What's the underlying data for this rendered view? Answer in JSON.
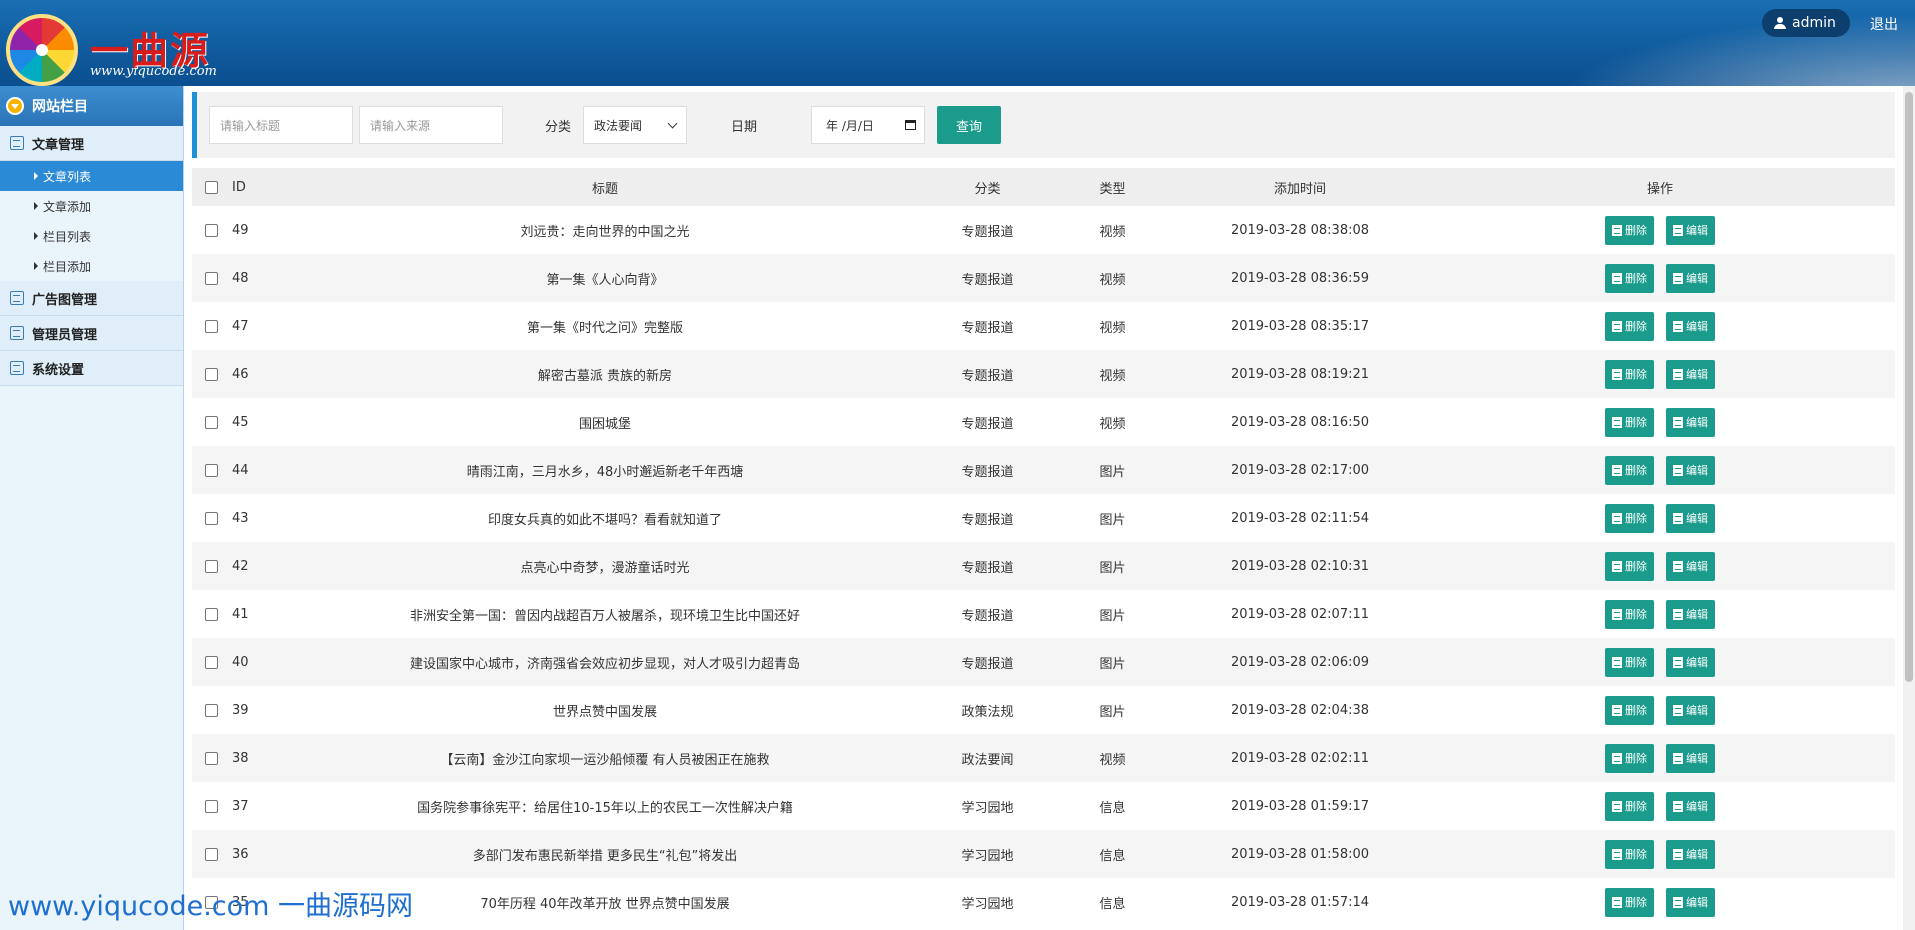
{
  "header": {
    "brand": "一曲源码",
    "brand_url": "www.yiqucode.com",
    "user": "admin",
    "logout": "退出"
  },
  "sidebar": {
    "title": "网站栏目",
    "groups": [
      {
        "label": "文章管理",
        "icon": "article-icon"
      },
      {
        "label": "广告图管理",
        "icon": "image-icon"
      },
      {
        "label": "管理员管理",
        "icon": "edit-icon"
      },
      {
        "label": "系统设置",
        "icon": "calendar-icon"
      }
    ],
    "subitems": [
      {
        "label": "文章列表",
        "active": true
      },
      {
        "label": "文章添加",
        "active": false
      },
      {
        "label": "栏目列表",
        "active": false
      },
      {
        "label": "栏目添加",
        "active": false
      }
    ]
  },
  "search": {
    "title_placeholder": "请输入标题",
    "source_placeholder": "请输入来源",
    "category_label": "分类",
    "category_value": "政法要闻",
    "date_label": "日期",
    "date_value": "年 /月/日",
    "query_button": "查询"
  },
  "table": {
    "headers": {
      "id": "ID",
      "title": "标题",
      "category": "分类",
      "type": "类型",
      "time": "添加时间",
      "ops": "操作"
    },
    "delete_label": "删除",
    "edit_label": "编辑",
    "rows": [
      {
        "id": "49",
        "title": "刘远贵：走向世界的中国之光",
        "category": "专题报道",
        "type": "视频",
        "time": "2019-03-28 08:38:08"
      },
      {
        "id": "48",
        "title": "第一集《人心向背》",
        "category": "专题报道",
        "type": "视频",
        "time": "2019-03-28 08:36:59"
      },
      {
        "id": "47",
        "title": "第一集《时代之问》完整版",
        "category": "专题报道",
        "type": "视频",
        "time": "2019-03-28 08:35:17"
      },
      {
        "id": "46",
        "title": "解密古墓派 贵族的新房",
        "category": "专题报道",
        "type": "视频",
        "time": "2019-03-28 08:19:21"
      },
      {
        "id": "45",
        "title": "围困城堡",
        "category": "专题报道",
        "type": "视频",
        "time": "2019-03-28 08:16:50"
      },
      {
        "id": "44",
        "title": "晴雨江南，三月水乡，48小时邂逅新老千年西塘",
        "category": "专题报道",
        "type": "图片",
        "time": "2019-03-28 02:17:00"
      },
      {
        "id": "43",
        "title": "印度女兵真的如此不堪吗？看看就知道了",
        "category": "专题报道",
        "type": "图片",
        "time": "2019-03-28 02:11:54"
      },
      {
        "id": "42",
        "title": "点亮心中奇梦，漫游童话时光",
        "category": "专题报道",
        "type": "图片",
        "time": "2019-03-28 02:10:31"
      },
      {
        "id": "41",
        "title": "非洲安全第一国：曾因内战超百万人被屠杀，现环境卫生比中国还好",
        "category": "专题报道",
        "type": "图片",
        "time": "2019-03-28 02:07:11"
      },
      {
        "id": "40",
        "title": "建设国家中心城市，济南强省会效应初步显现，对人才吸引力超青岛",
        "category": "专题报道",
        "type": "图片",
        "time": "2019-03-28 02:06:09"
      },
      {
        "id": "39",
        "title": "世界点赞中国发展",
        "category": "政策法规",
        "type": "图片",
        "time": "2019-03-28 02:04:38"
      },
      {
        "id": "38",
        "title": "【云南】金沙江向家坝一运沙船倾覆 有人员被困正在施救",
        "category": "政法要闻",
        "type": "视频",
        "time": "2019-03-28 02:02:11"
      },
      {
        "id": "37",
        "title": "国务院参事徐宪平：给居住10-15年以上的农民工一次性解决户籍",
        "category": "学习园地",
        "type": "信息",
        "time": "2019-03-28 01:59:17"
      },
      {
        "id": "36",
        "title": "多部门发布惠民新举措 更多民生“礼包”将发出",
        "category": "学习园地",
        "type": "信息",
        "time": "2019-03-28 01:58:00"
      },
      {
        "id": "35",
        "title": "70年历程 40年改革开放 世界点赞中国发展",
        "category": "学习园地",
        "type": "信息",
        "time": "2019-03-28 01:57:14"
      }
    ]
  },
  "watermark": "www.yiqucode.com  一曲源码网",
  "colors": {
    "accent": "#1a9b8b",
    "header": "#0f5a9d",
    "active": "#2b8ad6"
  }
}
